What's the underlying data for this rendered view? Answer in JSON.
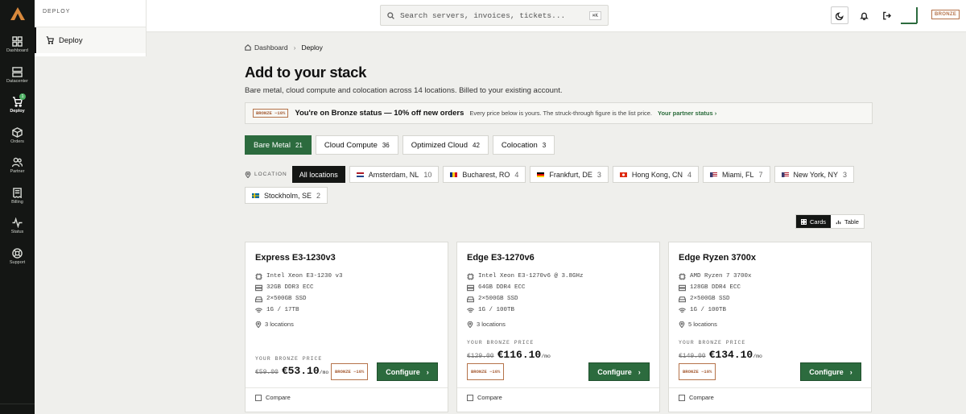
{
  "sidebar": {
    "items": [
      {
        "label": "Dashboard",
        "icon": "grid-icon"
      },
      {
        "label": "Datacenter",
        "icon": "server-icon"
      },
      {
        "label": "Deploy",
        "icon": "cart-icon",
        "badge": "1"
      },
      {
        "label": "Orders",
        "icon": "box-icon"
      },
      {
        "label": "Partner",
        "icon": "users-icon"
      },
      {
        "label": "Billing",
        "icon": "receipt-icon"
      },
      {
        "label": "Status",
        "icon": "pulse-icon"
      },
      {
        "label": "Support",
        "icon": "lifebuoy-icon"
      }
    ]
  },
  "subnav": {
    "heading": "DEPLOY",
    "item": "Deploy"
  },
  "topbar": {
    "search_placeholder": "Search servers, invoices, tickets...",
    "shortcut": "⌘K",
    "tier": "BRONZE"
  },
  "breadcrumb": {
    "home": "Dashboard",
    "current": "Deploy"
  },
  "page": {
    "title": "Add to your stack",
    "subtitle": "Bare metal, cloud compute and colocation across 14 locations. Billed to your existing account."
  },
  "status": {
    "chip": "BRONZE −10%",
    "headline": "You're on Bronze status — 10% off new orders",
    "detail": "Every price below is yours. The struck-through figure is the list price.",
    "link": "Your partner status ›"
  },
  "types": [
    {
      "label": "Bare Metal",
      "count": "21",
      "active": true
    },
    {
      "label": "Cloud Compute",
      "count": "36"
    },
    {
      "label": "Optimized Cloud",
      "count": "42"
    },
    {
      "label": "Colocation",
      "count": "3"
    }
  ],
  "location_label": "LOCATION",
  "locations": [
    {
      "label": "All locations",
      "count": "",
      "active": true
    },
    {
      "label": "Amsterdam, NL",
      "count": "10",
      "flag": "nl"
    },
    {
      "label": "Bucharest, RO",
      "count": "4",
      "flag": "ro"
    },
    {
      "label": "Frankfurt, DE",
      "count": "3",
      "flag": "de"
    },
    {
      "label": "Hong Kong, CN",
      "count": "4",
      "flag": "hk"
    },
    {
      "label": "Miami, FL",
      "count": "7",
      "flag": "us"
    },
    {
      "label": "New York, NY",
      "count": "3",
      "flag": "us"
    },
    {
      "label": "Stockholm, SE",
      "count": "2",
      "flag": "se"
    }
  ],
  "view": {
    "cards": "Cards",
    "table": "Table"
  },
  "products": [
    {
      "name": "Express E3-1230v3",
      "cpu": "Intel Xeon E3-1230 v3",
      "ram": "32GB DDR3 ECC",
      "disk": "2×500GB SSD",
      "net": "1G / 17TB",
      "locations": "3 locations",
      "price_label": "YOUR BRONZE PRICE",
      "list": "€59.00",
      "price": "€53.10",
      "per": "/mo",
      "discount": "BRONZE −10%",
      "cta": "Configure",
      "compare": "Compare"
    },
    {
      "name": "Edge E3-1270v6",
      "cpu": "Intel Xeon E3-1270v6 @ 3.8GHz",
      "ram": "64GB DDR4 ECC",
      "disk": "2×500GB SSD",
      "net": "1G / 100TB",
      "locations": "3 locations",
      "price_label": "YOUR BRONZE PRICE",
      "list": "€129.00",
      "price": "€116.10",
      "per": "/mo",
      "discount": "BRONZE −10%",
      "cta": "Configure",
      "compare": "Compare"
    },
    {
      "name": "Edge Ryzen 3700x",
      "cpu": "AMD Ryzen 7 3700x",
      "ram": "128GB DDR4 ECC",
      "disk": "2×500GB SSD",
      "net": "1G / 100TB",
      "locations": "5 locations",
      "price_label": "YOUR BRONZE PRICE",
      "list": "€149.00",
      "price": "€134.10",
      "per": "/mo",
      "discount": "BRONZE −10%",
      "cta": "Configure",
      "compare": "Compare"
    }
  ],
  "colors": {
    "accent": "#2c6b3e",
    "bronze": "#b5734a",
    "rail": "#141614"
  }
}
